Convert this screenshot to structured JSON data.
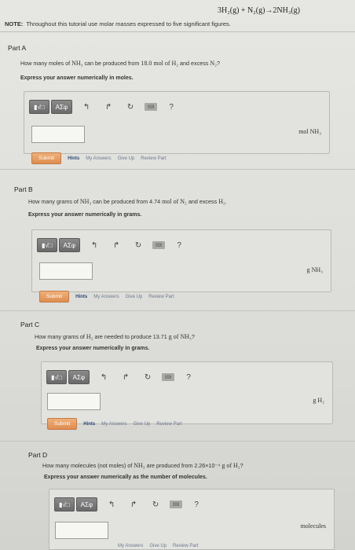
{
  "header": {
    "equation": "3H₂(g) + N₂(g)→2NH₃(g)",
    "note_label": "NOTE:",
    "note_text": "Throughout this tutorial use molar masses expressed to five significant figures."
  },
  "toolbar": {
    "sqrt_label": "▮√□",
    "greek_label": "ΑΣφ",
    "help_label": "?"
  },
  "actions": {
    "submit": "Submit",
    "hints": "Hints",
    "my_answers": "My Answers",
    "give_up": "Give Up",
    "review_part": "Review Part"
  },
  "parts": [
    {
      "title": "Part A",
      "q1": "How many moles of ",
      "c1": "NH₃",
      "q2": " can be produced from ",
      "c2": "18.0 mol of H₂",
      "q3": " and excess ",
      "c3": "N₂",
      "q4": "?",
      "instruction": "Express your answer numerically in moles.",
      "units": "mol NH₃",
      "answer": ""
    },
    {
      "title": "Part B",
      "q1": "How many grams of ",
      "c1": "NH₃",
      "q2": " can be produced from 4.74 ",
      "c2": "mol of N₂",
      "q3": " and excess ",
      "c3": "H₂",
      "q4": ".",
      "instruction": "Express your answer numerically in grams.",
      "units": "g NH₃",
      "answer": ""
    },
    {
      "title": "Part C",
      "q1": "How many grams of ",
      "c1": "H₂",
      "q2": " are needed to produce 13.71 ",
      "c2": "g of NH₃",
      "q3": "",
      "c3": "",
      "q4": "?",
      "instruction": "Express your answer numerically in grams.",
      "units": "g H₂",
      "answer": ""
    },
    {
      "title": "Part D",
      "q1": "How many molecules (not moles) of ",
      "c1": "NH₃",
      "q2": " are produced from 2.26×10⁻⁴ ",
      "c2": "g of H₂",
      "q3": "",
      "c3": "",
      "q4": "?",
      "instruction": "Express your answer numerically as the number of molecules.",
      "units": "molecules",
      "answer": ""
    }
  ]
}
